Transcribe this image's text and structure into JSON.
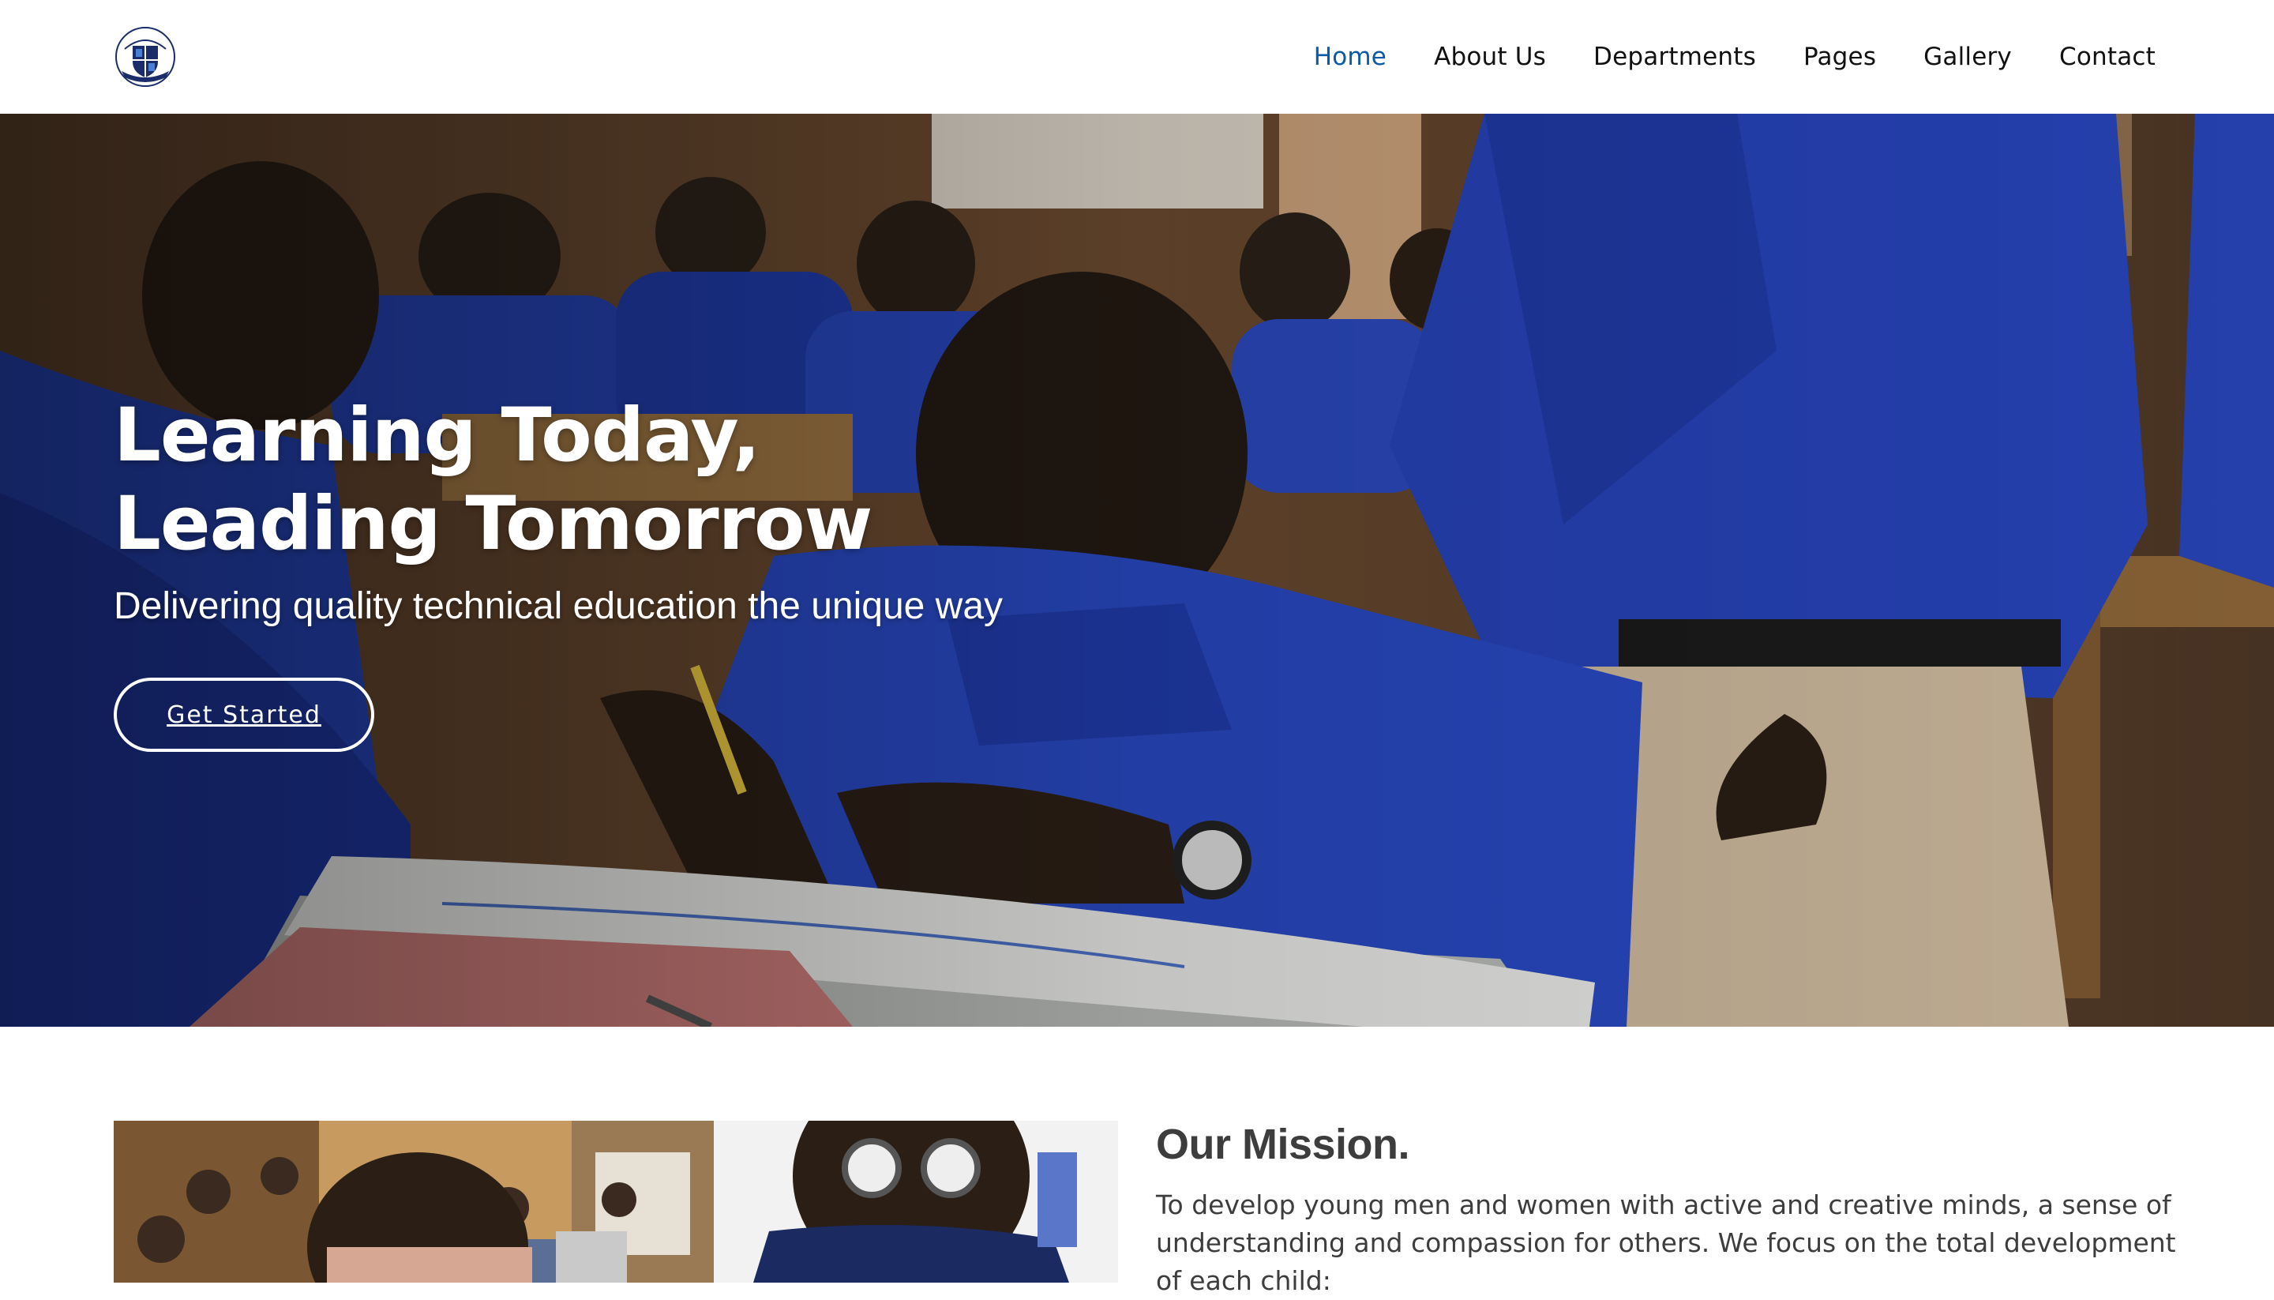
{
  "nav": {
    "items": [
      {
        "label": "Home",
        "active": true
      },
      {
        "label": "About Us",
        "active": false
      },
      {
        "label": "Departments",
        "active": false
      },
      {
        "label": "Pages",
        "active": false
      },
      {
        "label": "Gallery",
        "active": false
      },
      {
        "label": "Contact",
        "active": false
      }
    ]
  },
  "hero": {
    "title_line1": "Learning Today,",
    "title_line2": "Leading Tomorrow",
    "subtitle": "Delivering quality technical education the unique way",
    "cta_label": "Get Started"
  },
  "mission": {
    "title": "Our Mission.",
    "body": "To develop young men and women with active and creative minds, a sense of understanding and compassion for others. We focus on the total development of each child:"
  },
  "colors": {
    "accent": "#0a5aa5",
    "uniform_blue": "#1e3fb0",
    "text_dark": "#3d3d3d"
  }
}
